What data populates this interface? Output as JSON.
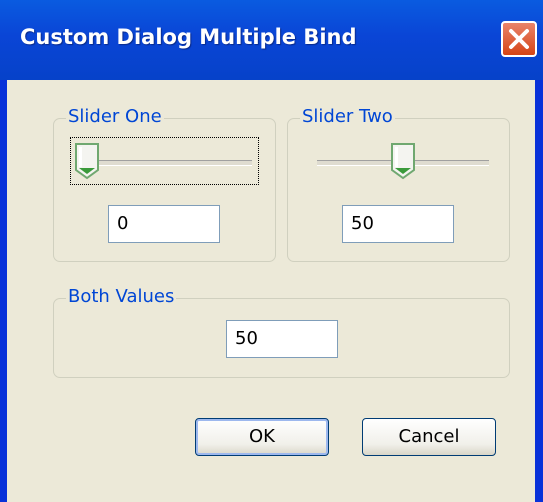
{
  "window": {
    "title": "Custom Dialog Multiple Bind"
  },
  "group_one": {
    "label": "Slider One",
    "slider_value": 0,
    "slider_max": 100,
    "field_value": "0"
  },
  "group_two": {
    "label": "Slider Two",
    "slider_value": 50,
    "slider_max": 100,
    "field_value": "50"
  },
  "group_both": {
    "label": "Both Values",
    "field_value": "50"
  },
  "buttons": {
    "ok": "OK",
    "cancel": "Cancel"
  },
  "icons": {
    "close": "close-icon",
    "slider_thumb": "slider-thumb-icon"
  },
  "colors": {
    "titlebar": "#0a45d6",
    "client": "#ece9d8",
    "legend": "#0046d5",
    "close": "#d54416"
  }
}
